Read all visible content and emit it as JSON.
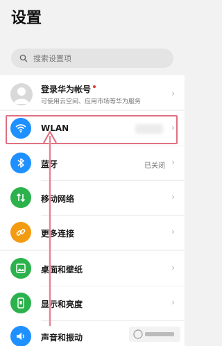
{
  "header": {
    "title": "设置"
  },
  "search": {
    "placeholder": "搜索设置项",
    "icon": "search-icon"
  },
  "account": {
    "title": "登录华为帐号",
    "subtitle": "可使用云空间、应用市场等华为服务",
    "badge_color": "#e03a3a"
  },
  "group1": {
    "items": [
      {
        "label": "WLAN",
        "value": "",
        "icon": "wifi-icon",
        "color": "#1e90ff"
      },
      {
        "label": "蓝牙",
        "value": "已关闭",
        "icon": "bluetooth-icon",
        "color": "#1e90ff"
      },
      {
        "label": "移动网络",
        "value": "",
        "icon": "mobile-network-icon",
        "color": "#2bb24c"
      },
      {
        "label": "更多连接",
        "value": "",
        "icon": "link-icon",
        "color": "#f39c12"
      }
    ]
  },
  "group2": {
    "items": [
      {
        "label": "桌面和壁纸",
        "icon": "wallpaper-icon",
        "color": "#2bb24c"
      },
      {
        "label": "显示和亮度",
        "icon": "display-icon",
        "color": "#2bb24c"
      },
      {
        "label": "声音和振动",
        "icon": "sound-icon",
        "color": "#1e90ff"
      }
    ]
  },
  "annotation": {
    "highlight_color": "#e07080"
  }
}
